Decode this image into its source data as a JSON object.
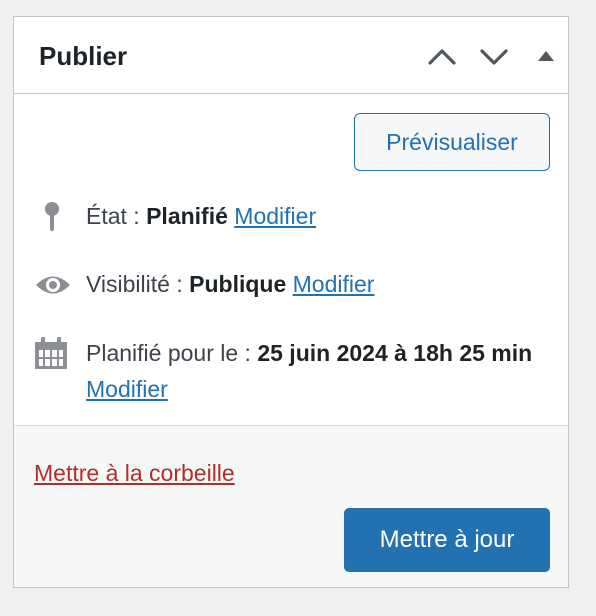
{
  "box": {
    "title": "Publier",
    "header_icons": [
      "chevron-up-icon",
      "chevron-down-icon",
      "triangle-up-icon"
    ]
  },
  "preview_button": "Prévisualiser",
  "status": {
    "icon": "pin-icon",
    "label": "État : ",
    "value": "Planifié",
    "edit_link": "Modifier"
  },
  "visibility": {
    "icon": "eye-icon",
    "label": "Visibilité : ",
    "value": "Publique",
    "edit_link": "Modifier"
  },
  "schedule": {
    "icon": "calendar-icon",
    "label": "Planifié pour le : ",
    "value": "25 juin 2024 à 18h 25 min",
    "edit_link": "Modifier"
  },
  "trash_link": "Mettre à la corbeille",
  "update_button": "Mettre à jour",
  "colors": {
    "accent": "#2271b1",
    "danger": "#b32d2e",
    "text": "#1d2327",
    "muted": "#3c434a"
  }
}
